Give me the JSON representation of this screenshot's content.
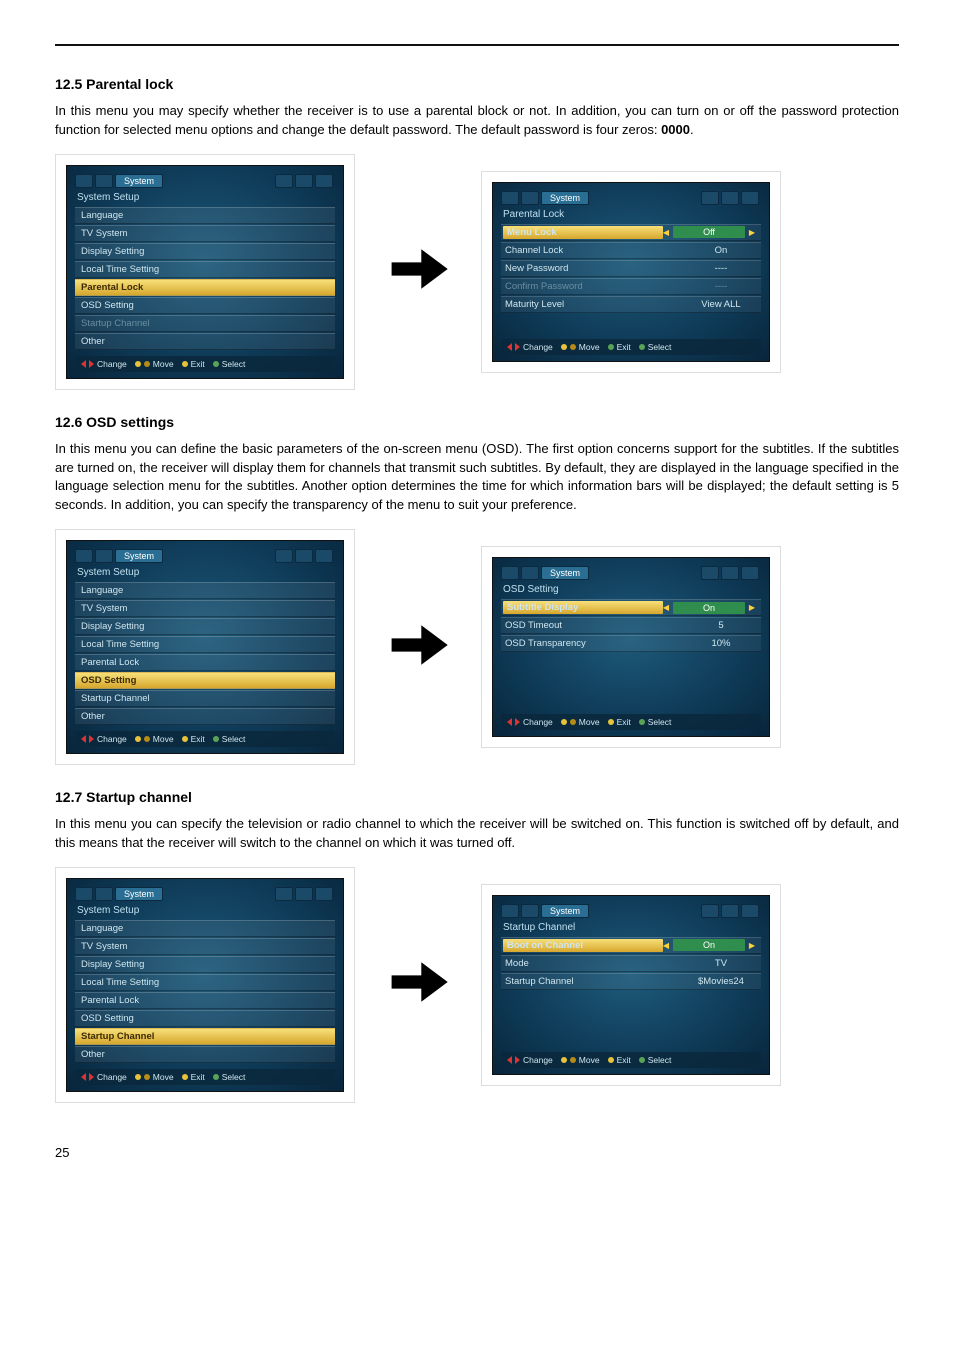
{
  "page_number": "25",
  "sections": {
    "parental": {
      "heading": "12.5 Parental lock",
      "body_pre": "In this menu you may specify whether the receiver is to use a parental block or not. In addition, you can turn on or off the password protection function for selected menu options and change the default password. The default password is four zeros: ",
      "body_bold": "0000",
      "body_post": "."
    },
    "osd": {
      "heading": "12.6 OSD settings",
      "body": "In this menu you can define the basic parameters of the on-screen menu (OSD). The first option concerns support for the subtitles. If the subtitles are turned on, the receiver will display them for channels that transmit such subtitles. By default, they are displayed in the language specified in the language selection menu for the subtitles. Another option determines the time for which information bars will be displayed; the default setting is 5 seconds. In addition, you can specify the transparency of the menu to suit your preference."
    },
    "startup": {
      "heading": "12.7 Startup channel",
      "body": "In this menu you can specify the television or radio channel to which the receiver will be switched on. This function is switched off by default, and this means that the receiver will switch to the channel on which it was turned off."
    }
  },
  "footer": {
    "change": "Change",
    "move": "Move",
    "exit": "Exit",
    "select": "Select"
  },
  "tab_label": "System",
  "screens": {
    "system_setup": {
      "title": "System Setup",
      "items": [
        "Language",
        "TV System",
        "Display Setting",
        "Local Time Setting",
        "Parental Lock",
        "OSD Setting",
        "Startup Channel",
        "Other"
      ]
    },
    "parental_right": {
      "title": "Parental Lock",
      "rows": [
        {
          "k": "Menu Lock",
          "v": "Off",
          "sel": true
        },
        {
          "k": "Channel Lock",
          "v": "On"
        },
        {
          "k": "New Password",
          "v": "----"
        },
        {
          "k": "Confirm Password",
          "v": "----",
          "dim": true
        },
        {
          "k": "Maturity Level",
          "v": "View ALL"
        }
      ]
    },
    "osd_right": {
      "title": "OSD Setting",
      "rows": [
        {
          "k": "Subtitle Display",
          "v": "On",
          "sel": true
        },
        {
          "k": "OSD Timeout",
          "v": "5"
        },
        {
          "k": "OSD Transparency",
          "v": "10%"
        }
      ]
    },
    "startup_right": {
      "title": "Startup Channel",
      "rows": [
        {
          "k": "Boot on Channel",
          "v": "On",
          "sel": true
        },
        {
          "k": "Mode",
          "v": "TV"
        },
        {
          "k": "Startup Channel",
          "v": "$Movies24"
        }
      ]
    }
  }
}
